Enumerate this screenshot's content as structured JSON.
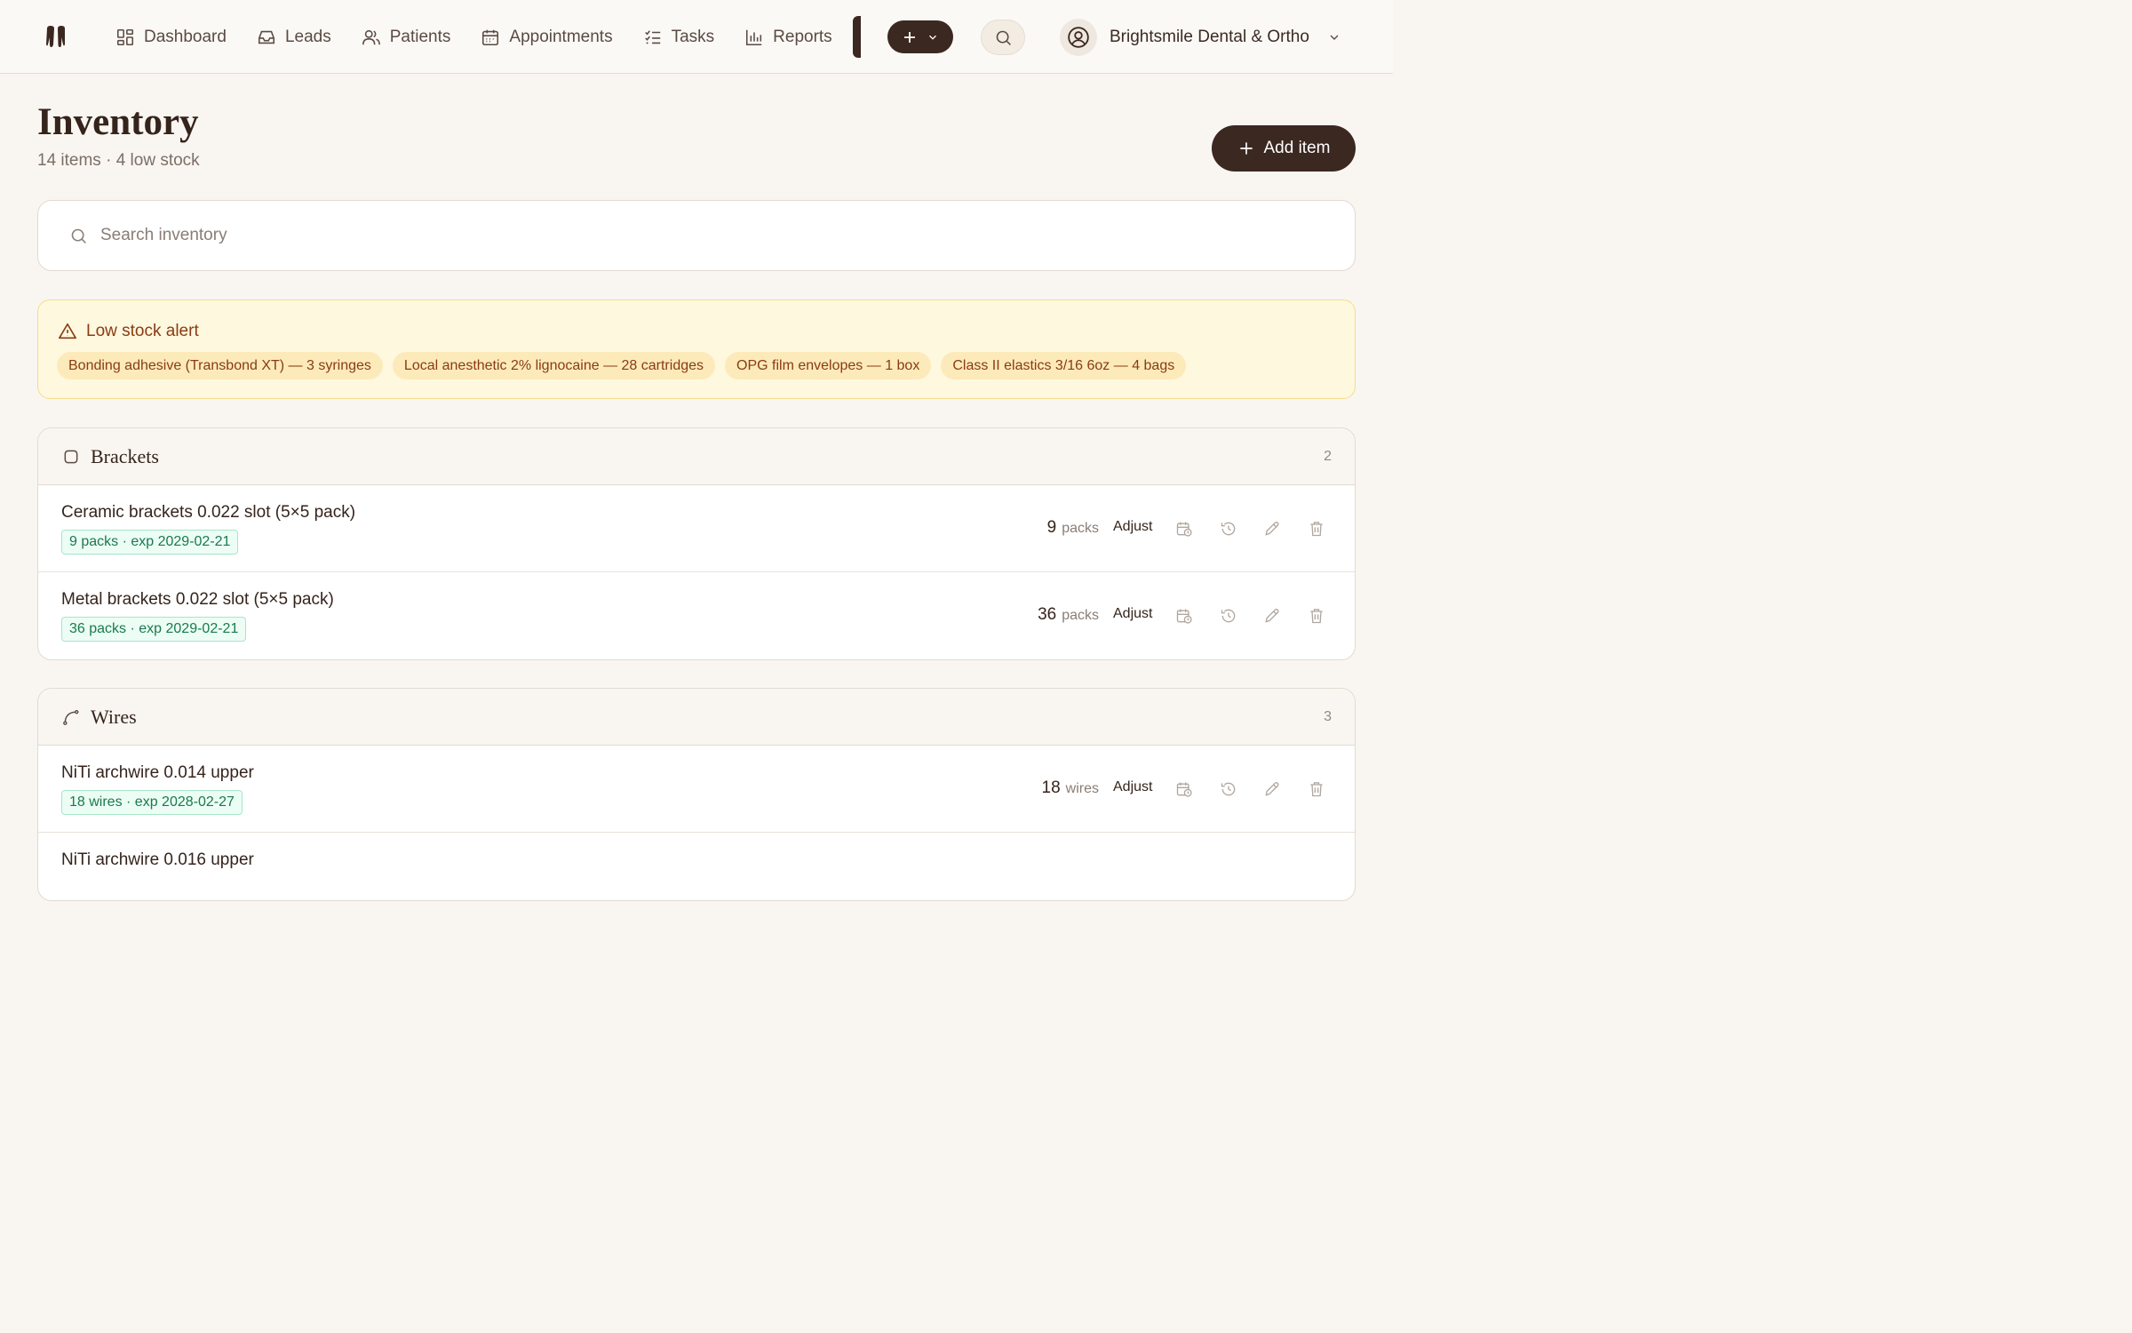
{
  "nav": {
    "items": [
      {
        "label": "Dashboard",
        "icon": "dashboard-icon"
      },
      {
        "label": "Leads",
        "icon": "inbox-icon"
      },
      {
        "label": "Patients",
        "icon": "users-icon"
      },
      {
        "label": "Appointments",
        "icon": "calendar-icon"
      },
      {
        "label": "Tasks",
        "icon": "checklist-icon"
      },
      {
        "label": "Reports",
        "icon": "bar-chart-icon"
      }
    ],
    "account_name": "Brightsmile Dental & Ortho"
  },
  "header": {
    "title": "Inventory",
    "subtitle": "14 items · 4 low stock",
    "add_label": "Add item"
  },
  "search": {
    "placeholder": "Search inventory",
    "value": ""
  },
  "alert": {
    "title": "Low stock alert",
    "chips": [
      "Bonding adhesive (Transbond XT) — 3 syringes",
      "Local anesthetic 2% lignocaine — 28 cartridges",
      "OPG film envelopes — 1 box",
      "Class II elastics 3/16 6oz — 4 bags"
    ]
  },
  "sections": [
    {
      "title": "Brackets",
      "count": "2",
      "icon": "square-icon",
      "items": [
        {
          "name": "Ceramic brackets 0.022 slot (5×5 pack)",
          "badge": "9 packs · exp 2029-02-21",
          "qty": "9",
          "unit": "packs",
          "adjust": "Adjust"
        },
        {
          "name": "Metal brackets 0.022 slot (5×5 pack)",
          "badge": "36 packs · exp 2029-02-21",
          "qty": "36",
          "unit": "packs",
          "adjust": "Adjust"
        }
      ]
    },
    {
      "title": "Wires",
      "count": "3",
      "icon": "wire-icon",
      "items": [
        {
          "name": "NiTi archwire 0.014 upper",
          "badge": "18 wires · exp 2028-02-27",
          "qty": "18",
          "unit": "wires",
          "adjust": "Adjust"
        },
        {
          "name": "NiTi archwire 0.016 upper",
          "badge": "",
          "qty": "",
          "unit": "",
          "adjust": ""
        }
      ]
    }
  ],
  "colors": {
    "brand_dark": "#3b2820",
    "background": "#f9f6f2",
    "alert_bg": "#fef8df",
    "alert_text": "#8a3b12",
    "badge_green": "#197a4c"
  }
}
